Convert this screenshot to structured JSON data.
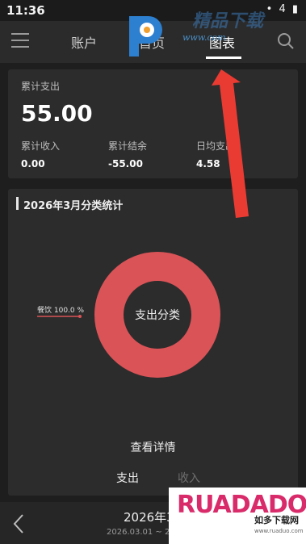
{
  "status_bar": {
    "time": "11:36",
    "icons": "• 4 ▮"
  },
  "nav": {
    "tabs": [
      {
        "label": "账户"
      },
      {
        "label": "首页"
      },
      {
        "label": "图表"
      }
    ],
    "active_tab": "图表"
  },
  "watermark": {
    "brand": "精品下载",
    "url": "www.com"
  },
  "summary": {
    "total_expense_label": "累计支出",
    "total_expense_value": "55.00",
    "income_label": "累计收入",
    "income_value": "0.00",
    "balance_label": "累计结余",
    "balance_value": "-55.00",
    "daily_avg_label": "日均支出",
    "daily_avg_value": "4.58"
  },
  "chart_card": {
    "title": "2026年3月分类统计",
    "center_label": "支出分类",
    "detail_link": "查看详情",
    "toggle_expense": "支出",
    "toggle_income": "收入"
  },
  "chart_data": {
    "type": "pie",
    "title": "2026年3月分类统计",
    "categories": [
      "餐饮"
    ],
    "values": [
      100.0
    ],
    "slice_labels": [
      "餐饮 100.0 %"
    ],
    "center_label": "支出分类",
    "colors": [
      "#d95357"
    ]
  },
  "bottom": {
    "month": "2026年3",
    "range": "2026.03.01 ~ 20"
  },
  "ad": {
    "main": "RUADADO",
    "sub": "如多下载网",
    "url": "www.ruaduo.com"
  },
  "colors": {
    "background": "#1e1e1e",
    "card": "#2c2c2c",
    "donut": "#d95357",
    "arrow": "#ea3b33"
  }
}
